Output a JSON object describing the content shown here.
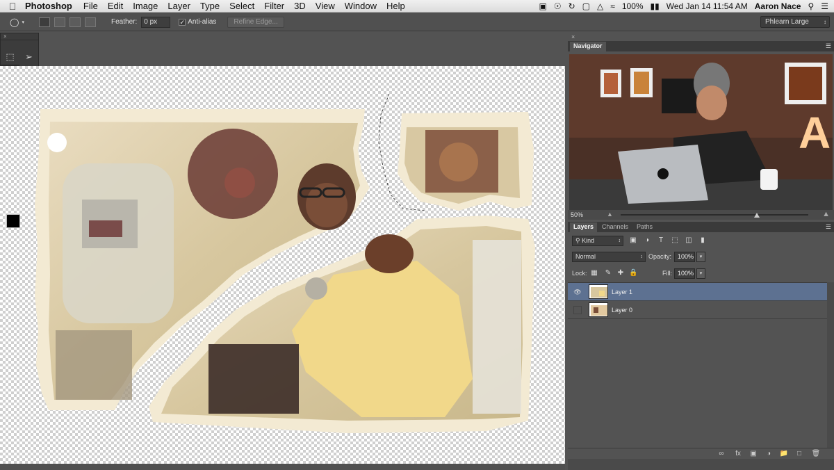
{
  "menubar": {
    "app_name": "Photoshop",
    "items": [
      "File",
      "Edit",
      "Image",
      "Layer",
      "Type",
      "Select",
      "Filter",
      "3D",
      "View",
      "Window",
      "Help"
    ],
    "battery": "100%",
    "datetime": "Wed Jan 14  11:54 AM",
    "user": "Aaron Nace"
  },
  "options": {
    "feather_label": "Feather:",
    "feather_value": "0 px",
    "antialias_label": "Anti-alias",
    "antialias_checked": "✓",
    "refine_edge": "Refine Edge...",
    "workspace": "Phlearn Large"
  },
  "navigator": {
    "tab": "Navigator",
    "zoom": "50%"
  },
  "layers_panel": {
    "tabs": [
      "Layers",
      "Channels",
      "Paths"
    ],
    "filter_kind": "Kind",
    "blend_mode": "Normal",
    "opacity_label": "Opacity:",
    "opacity_value": "100%",
    "lock_label": "Lock:",
    "fill_label": "Fill:",
    "fill_value": "100%",
    "layers": [
      {
        "name": "Layer 1",
        "visible": true,
        "selected": true
      },
      {
        "name": "Layer 0",
        "visible": false,
        "selected": false
      }
    ]
  },
  "colors": {
    "selection_blue": "#5d7191",
    "panel_gray": "#535353",
    "dark_gray": "#3a3a3a"
  }
}
